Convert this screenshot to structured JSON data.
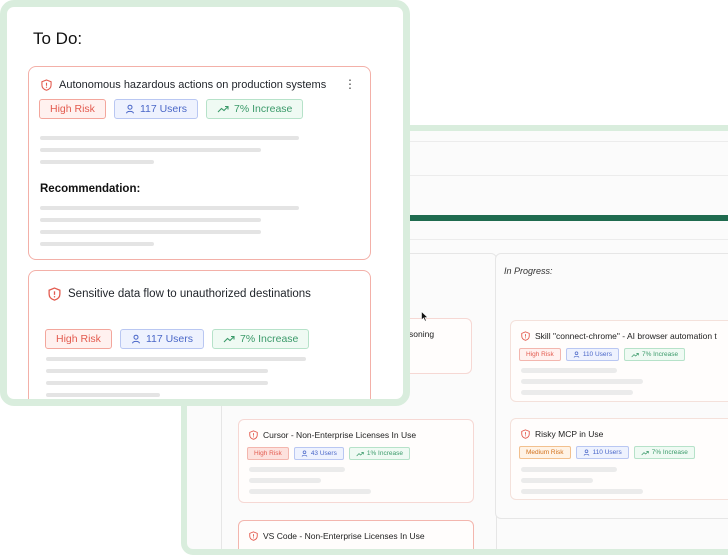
{
  "todo": {
    "title": "To Do:",
    "cards": [
      {
        "title": "Autonomous hazardous actions on production systems",
        "risk": "High Risk",
        "users": "117 Users",
        "increase": "7% Increase",
        "recommendation_label": "Recommendation:"
      },
      {
        "title": "Sensitive data flow to unauthorized destinations",
        "risk": "High Risk",
        "users": "117 Users",
        "increase": "7% Increase"
      }
    ]
  },
  "board": {
    "in_progress_label": "In Progress:",
    "left_column": {
      "partial_card_title": "soning",
      "cards": [
        {
          "title": "Cursor - Non-Enterprise Licenses In Use",
          "risk": "High Risk",
          "users": "43 Users",
          "increase": "1% Increase"
        },
        {
          "title": "VS Code - Non-Enterprise Licenses In Use"
        }
      ]
    },
    "right_column": {
      "cards": [
        {
          "title": "Skill \"connect-chrome\" - AI browser automation t",
          "risk": "High Risk",
          "users": "110 Users",
          "increase": "7% Increase"
        },
        {
          "title": "Risky MCP in Use",
          "risk": "Medium Risk",
          "users": "110 Users",
          "increase": "7% Increase"
        }
      ]
    }
  },
  "colors": {
    "frame": "#d9eddd",
    "progress": "#1f6b4f",
    "risk": "#e35b4f",
    "users": "#4a67c8",
    "increase": "#3b9a6a",
    "medium": "#d2711c"
  },
  "icons": [
    "shield-alert-icon",
    "user-icon",
    "trend-up-icon",
    "kebab-menu-icon",
    "mouse-cursor-icon"
  ]
}
